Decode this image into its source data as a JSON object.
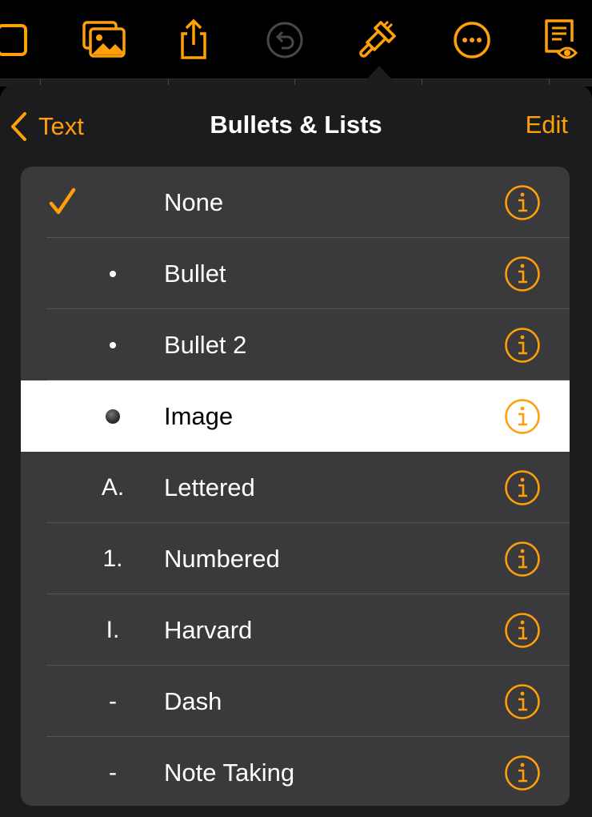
{
  "toolbar": {
    "icons": [
      "pages-icon",
      "media-icon",
      "share-icon",
      "undo-icon",
      "format-brush-icon",
      "more-icon",
      "reader-view-icon"
    ],
    "accent": "#ff9f0a",
    "disabled": "#48484a"
  },
  "popover": {
    "back_label": "Text",
    "title": "Bullets & Lists",
    "edit_label": "Edit"
  },
  "list": {
    "items": [
      {
        "label": "None",
        "marker": "",
        "checked": true
      },
      {
        "label": "Bullet",
        "marker": "•"
      },
      {
        "label": "Bullet 2",
        "marker": "•"
      },
      {
        "label": "Image",
        "marker": "image-bullet",
        "selected": true
      },
      {
        "label": "Lettered",
        "marker": "A."
      },
      {
        "label": "Numbered",
        "marker": "1."
      },
      {
        "label": "Harvard",
        "marker": "I."
      },
      {
        "label": "Dash",
        "marker": "-"
      },
      {
        "label": "Note Taking",
        "marker": "-"
      }
    ]
  }
}
